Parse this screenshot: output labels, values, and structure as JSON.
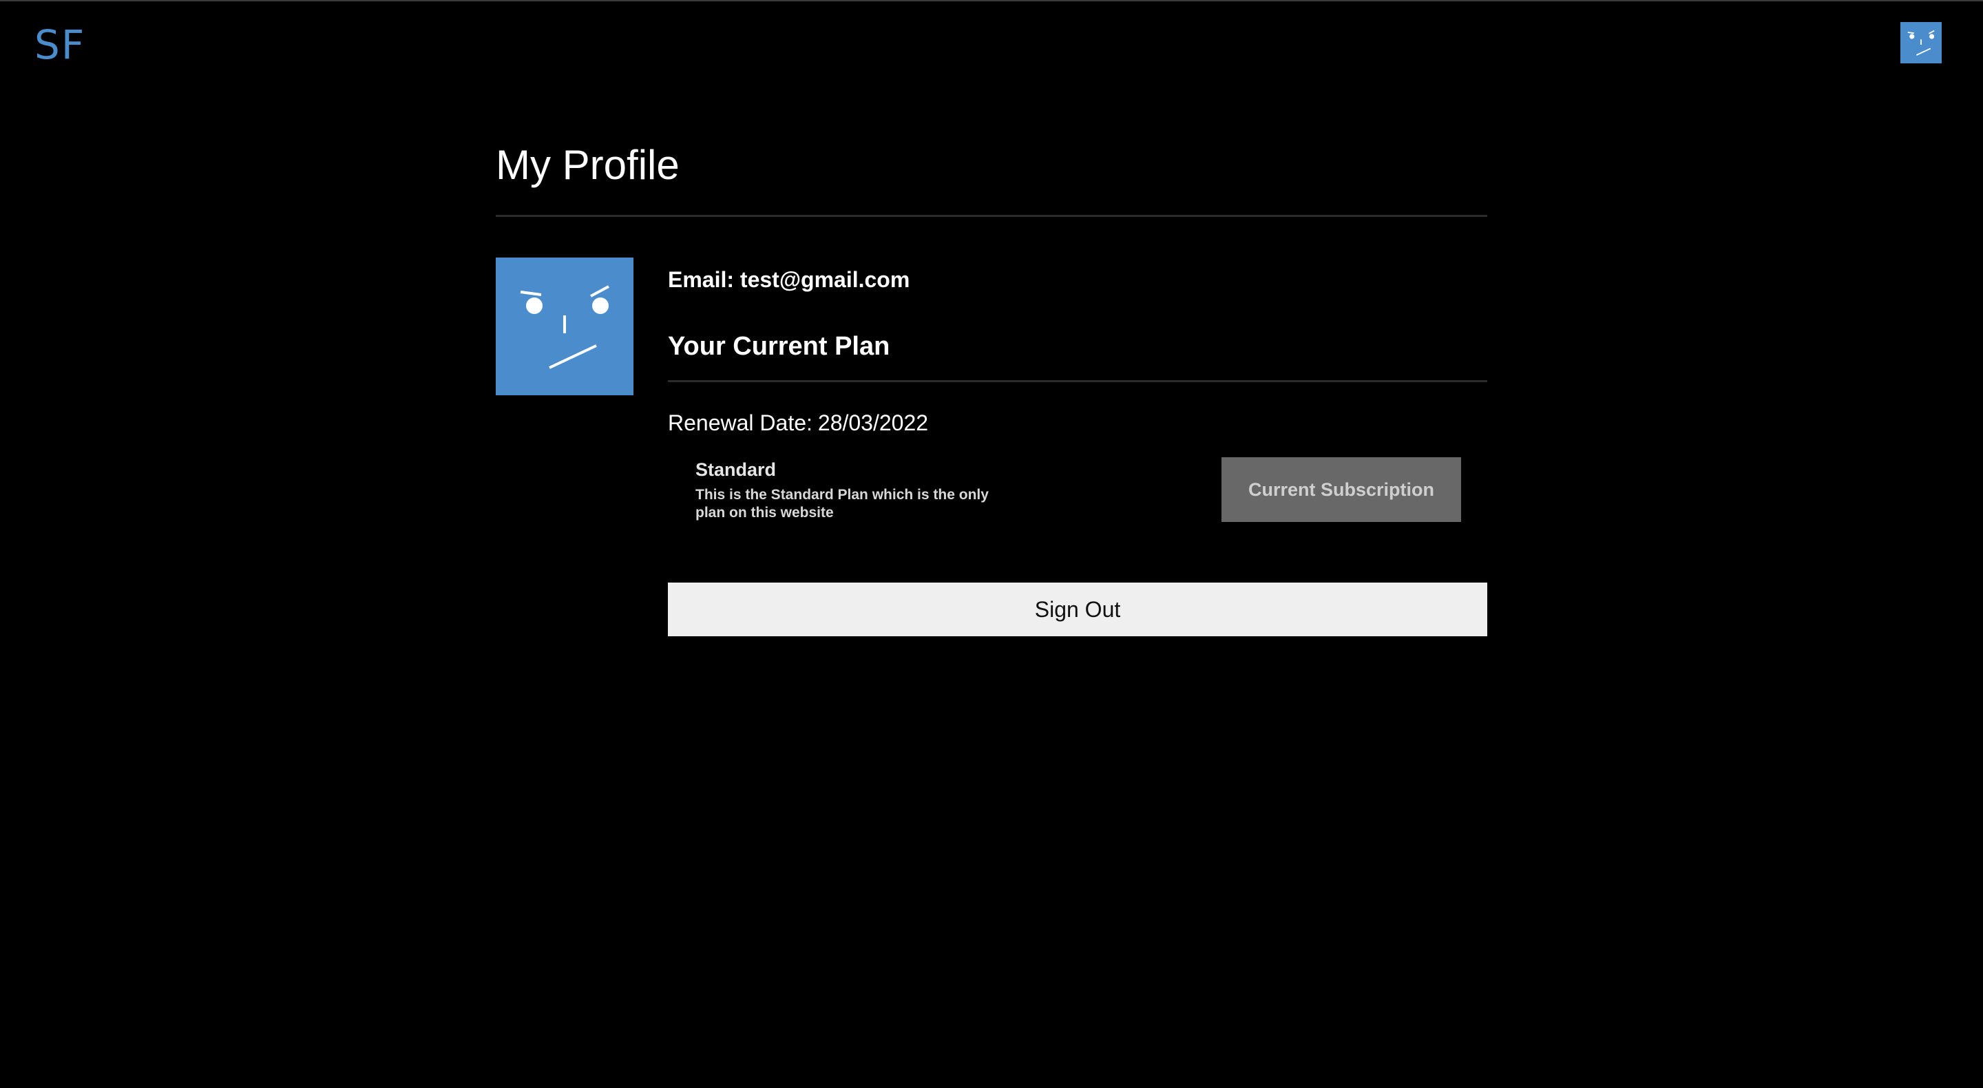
{
  "header": {
    "logo_text": "SF",
    "logo_color": "#4a8ccc",
    "avatar_icon": "netflix-style-face-icon",
    "avatar_bg": "#4a8ccc"
  },
  "profile": {
    "title": "My Profile",
    "avatar_icon": "netflix-style-face-icon",
    "email_label": "Email:",
    "email_value": "test@gmail.com",
    "plan_heading": "Your Current Plan",
    "renewal_label": "Renewal Date:",
    "renewal_value": "28/03/2022",
    "plans": [
      {
        "name": "Standard",
        "description": "This is the Standard Plan which is the only plan on this website",
        "button_label": "Current Subscription",
        "is_current": true
      }
    ],
    "signout_label": "Sign Out"
  },
  "colors": {
    "background": "#000000",
    "avatar": "#4a8ccc",
    "current_button": "#686868",
    "signout_button": "#efefef"
  }
}
